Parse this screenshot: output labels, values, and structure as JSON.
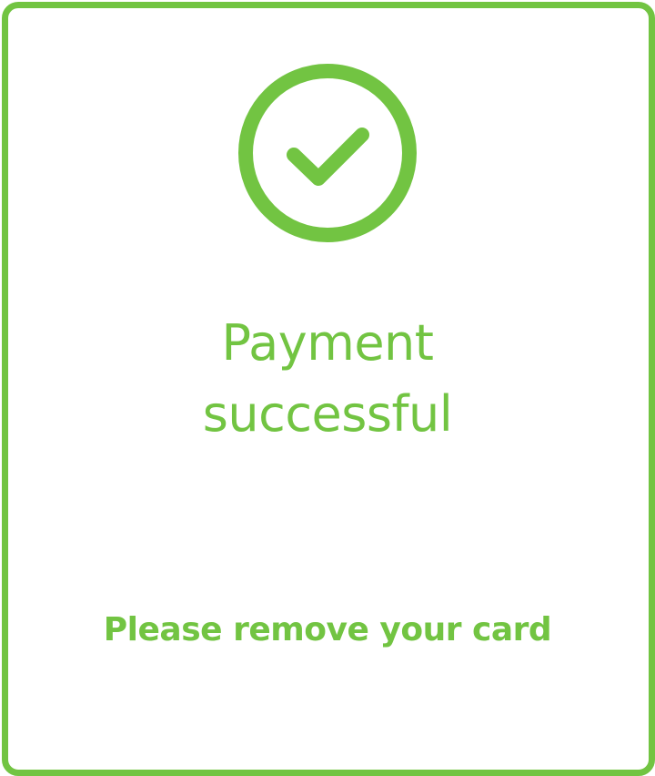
{
  "screen": {
    "status_title_line1": "Payment",
    "status_title_line2": "successful",
    "instruction": "Please remove your card",
    "status_icon": "check-circle-icon"
  },
  "colors": {
    "accent": "#72c442",
    "background": "#ffffff"
  }
}
